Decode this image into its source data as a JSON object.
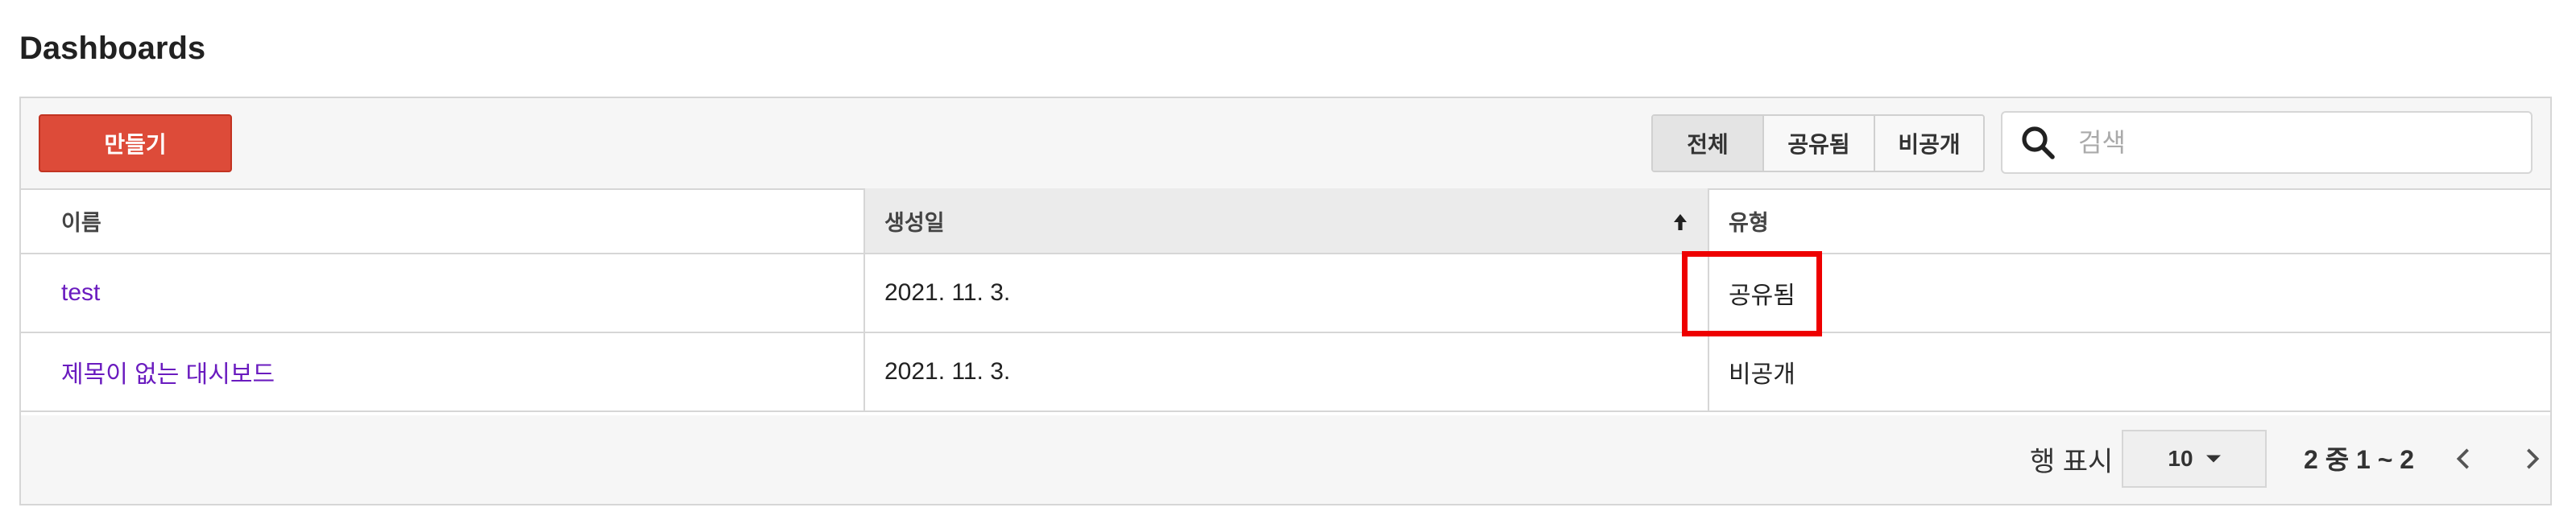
{
  "page": {
    "title": "Dashboards"
  },
  "toolbar": {
    "create_label": "만들기",
    "filters": [
      {
        "label": "전체",
        "active": true
      },
      {
        "label": "공유됨",
        "active": false
      },
      {
        "label": "비공개",
        "active": false
      }
    ],
    "search": {
      "placeholder": "검색",
      "value": "",
      "icon": "search-icon"
    }
  },
  "table": {
    "columns": [
      {
        "label": "이름"
      },
      {
        "label": "생성일",
        "sort": "ascending",
        "sort_icon": "sort-up-arrow-icon"
      },
      {
        "label": "유형"
      }
    ],
    "rows": [
      {
        "name": "test",
        "created": "2021. 11. 3.",
        "type": "공유됨",
        "highlighted": true
      },
      {
        "name": "제목이 없는 대시보드",
        "created": "2021. 11. 3.",
        "type": "비공개",
        "highlighted": false
      }
    ]
  },
  "pagination": {
    "rows_label": "행 표시",
    "rows_per_page": "10",
    "range_text": "2 중 1 ~ 2",
    "prev_icon": "chevron-left-icon",
    "next_icon": "chevron-right-icon"
  },
  "colors": {
    "create_button": "#dd4b39",
    "link": "#6a1bbf",
    "highlight_border": "#ee0000"
  }
}
